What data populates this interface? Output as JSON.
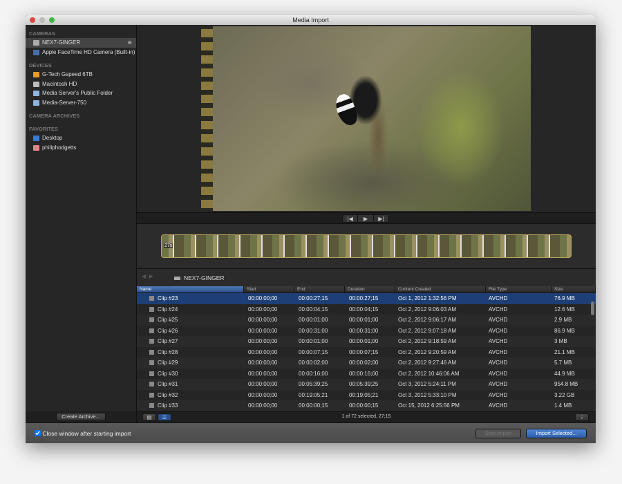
{
  "window": {
    "title": "Media Import"
  },
  "sidebar": {
    "sections": [
      {
        "header": "CAMERAS",
        "items": [
          {
            "label": "NEX7-GINGER",
            "icon": "camera-icon",
            "selected": true,
            "eject": true
          },
          {
            "label": "Apple FaceTime HD Camera (Built-in)",
            "icon": "webcam-icon"
          }
        ]
      },
      {
        "header": "DEVICES",
        "items": [
          {
            "label": "G-Tech Gspeed 6TB",
            "icon": "external-drive-icon"
          },
          {
            "label": "Macintosh HD",
            "icon": "hard-drive-icon"
          },
          {
            "label": "Media Server's Public Folder",
            "icon": "network-server-icon"
          },
          {
            "label": "Media-Server-750",
            "icon": "network-server-icon"
          }
        ]
      },
      {
        "header": "CAMERA ARCHIVES",
        "items": []
      },
      {
        "header": "FAVORITES",
        "items": [
          {
            "label": "Desktop",
            "icon": "desktop-icon"
          },
          {
            "label": "philiphodgetts",
            "icon": "home-icon"
          }
        ]
      }
    ],
    "create_archive": "Create Archive..."
  },
  "filmstrip": {
    "duration_label": "27s"
  },
  "pathbar": {
    "device": "NEX7-GINGER"
  },
  "table": {
    "columns": [
      "Name",
      "Start",
      "End",
      "Duration",
      "Content Created",
      "File Type",
      "Size"
    ],
    "rows": [
      [
        "Clip #23",
        "00:00:00;00",
        "00:00:27;15",
        "00:00:27;15",
        "Oct 1, 2012 1:32:56 PM",
        "AVCHD",
        "76.9 MB"
      ],
      [
        "Clip #24",
        "00:00:00;00",
        "00:00:04;15",
        "00:00:04;15",
        "Oct 2, 2012 9:06:03 AM",
        "AVCHD",
        "12.6 MB"
      ],
      [
        "Clip #25",
        "00:00:00;00",
        "00:00:01;00",
        "00:00:01;00",
        "Oct 2, 2012 9:06:17 AM",
        "AVCHD",
        "2.9 MB"
      ],
      [
        "Clip #26",
        "00:00:00;00",
        "00:00:31;00",
        "00:00:31;00",
        "Oct 2, 2012 9:07:18 AM",
        "AVCHD",
        "86.9 MB"
      ],
      [
        "Clip #27",
        "00:00:00;00",
        "00:00:01;00",
        "00:00:01;00",
        "Oct 2, 2012 9:18:59 AM",
        "AVCHD",
        "3 MB"
      ],
      [
        "Clip #28",
        "00:00:00;00",
        "00:00:07;15",
        "00:00:07;15",
        "Oct 2, 2012 9:20:59 AM",
        "AVCHD",
        "21.1 MB"
      ],
      [
        "Clip #29",
        "00:00:00;00",
        "00:00:02;00",
        "00:00:02;00",
        "Oct 2, 2012 9:27:46 AM",
        "AVCHD",
        "5.7 MB"
      ],
      [
        "Clip #30",
        "00:00:00;00",
        "00:00:16;00",
        "00:00:16;00",
        "Oct 2, 2012 10:46:06 AM",
        "AVCHD",
        "44.9 MB"
      ],
      [
        "Clip #31",
        "00:00:00;00",
        "00:05:39;25",
        "00:05:39;25",
        "Oct 3, 2012 5:24:11 PM",
        "AVCHD",
        "954.8 MB"
      ],
      [
        "Clip #32",
        "00:00:00;00",
        "00:19:05;21",
        "00:19:05;21",
        "Oct 3, 2012 5:33:10 PM",
        "AVCHD",
        "3.22 GB"
      ],
      [
        "Clip #33",
        "00:00:00;00",
        "00:00:00;15",
        "00:00:00;15",
        "Oct 15, 2012 6:25:56 PM",
        "AVCHD",
        "1.4 MB"
      ]
    ],
    "selected_index": 0,
    "status": "1 of 72 selected, 27;15"
  },
  "footer": {
    "close_checkbox_label": "Close window after starting import",
    "close_checked": true,
    "stop_import": "Stop Import",
    "import_selected": "Import Selected..."
  },
  "colors": {
    "selection": "#1d3f76",
    "accent": "#2f5fa8"
  }
}
